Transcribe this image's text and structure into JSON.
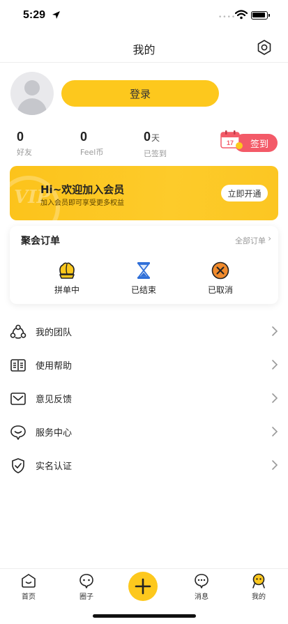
{
  "status_bar": {
    "time": "5:29"
  },
  "nav": {
    "title": "我的"
  },
  "profile": {
    "login_label": "登录"
  },
  "stats": [
    {
      "value": "0",
      "unit": "",
      "label": "好友"
    },
    {
      "value": "0",
      "unit": "",
      "label": "Feel币"
    },
    {
      "value": "0",
      "unit": "天",
      "label": "已签到"
    }
  ],
  "checkin": {
    "label": "签到",
    "calendar_day": "17"
  },
  "vip": {
    "title": "Hi~欢迎加入会员",
    "subtitle": "加入会员即可享受更多权益",
    "button_label": "立即开通",
    "watermark": "VIP"
  },
  "orders": {
    "title": "聚会订单",
    "all_label": "全部订单",
    "items": [
      {
        "label": "拼单中",
        "icon": "group-order-icon"
      },
      {
        "label": "已结束",
        "icon": "hourglass-icon"
      },
      {
        "label": "已取消",
        "icon": "cancel-icon"
      }
    ]
  },
  "menu": [
    {
      "label": "我的团队",
      "icon": "team-icon"
    },
    {
      "label": "使用帮助",
      "icon": "book-icon"
    },
    {
      "label": "意见反馈",
      "icon": "mail-icon"
    },
    {
      "label": "服务中心",
      "icon": "chat-service-icon"
    },
    {
      "label": "实名认证",
      "icon": "shield-check-icon"
    }
  ],
  "tabs": [
    {
      "label": "首页",
      "icon": "home-icon"
    },
    {
      "label": "圈子",
      "icon": "circle-icon"
    },
    {
      "label": "",
      "icon": "plus-icon"
    },
    {
      "label": "消息",
      "icon": "message-icon"
    },
    {
      "label": "我的",
      "icon": "profile-icon"
    }
  ],
  "colors": {
    "accent": "#fdc81d",
    "checkin": "#f35a68",
    "cancel": "#f08a2c",
    "hourglass": "#2f6fd8"
  }
}
